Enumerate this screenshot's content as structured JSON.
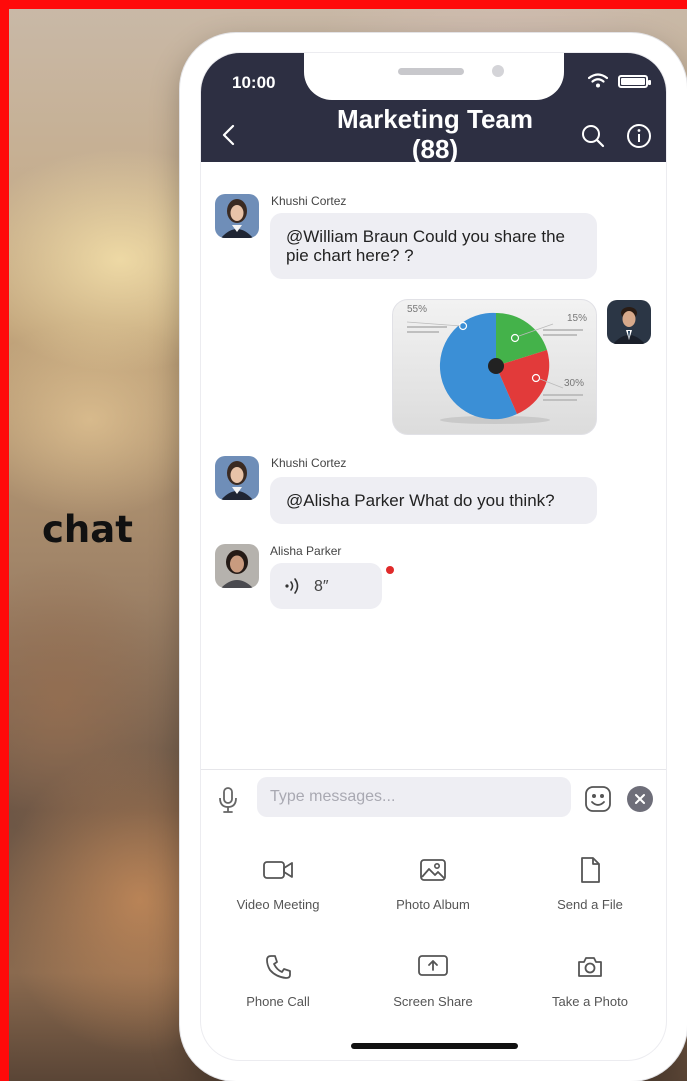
{
  "side_label": "chat",
  "status_bar": {
    "time": "10:00"
  },
  "header": {
    "title": "Marketing Team (88)"
  },
  "messages": [
    {
      "sender": "Khushi Cortez",
      "text": "@William Braun Could you share the pie chart here? ?"
    },
    {
      "image": "pie-chart",
      "chart_labels": [
        "55%",
        "15%",
        "30%"
      ]
    },
    {
      "sender": "Khushi Cortez",
      "text": "@Alisha Parker What do you think?"
    },
    {
      "sender": "Alisha Parker",
      "voice_duration": "8″"
    }
  ],
  "composer": {
    "placeholder": "Type messages..."
  },
  "actions": [
    {
      "label": "Video Meeting",
      "icon": "video-camera-icon"
    },
    {
      "label": "Photo Album",
      "icon": "photo-icon"
    },
    {
      "label": "Send a File",
      "icon": "file-icon"
    },
    {
      "label": "Phone Call",
      "icon": "phone-icon"
    },
    {
      "label": "Screen Share",
      "icon": "screen-share-icon"
    },
    {
      "label": "Take a Photo",
      "icon": "camera-icon"
    }
  ],
  "colors": {
    "header_bg": "#2d2f42",
    "bubble_bg": "#eeeef3",
    "unread": "#e02a2a"
  }
}
